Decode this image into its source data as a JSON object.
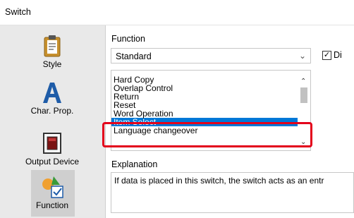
{
  "window": {
    "title": "Switch"
  },
  "sidebar": {
    "items": [
      {
        "label": "Style",
        "icon": "clipboard-icon"
      },
      {
        "label": "Char. Prop.",
        "icon": "letter-a-icon"
      },
      {
        "label": "Output Device",
        "icon": "switch-device-icon"
      },
      {
        "label": "Function",
        "icon": "shapes-icon",
        "selected": true
      }
    ]
  },
  "main": {
    "function_label": "Function",
    "function_value": "Standard",
    "checkbox_label": "Di",
    "checkbox_checked": true,
    "list_items": [
      "Hard Copy",
      "Overlap Control",
      "Return",
      "Reset",
      "Word Operation",
      "Item Select",
      "Language changeover"
    ],
    "selected_item": "Item Select",
    "explanation_label": "Explanation",
    "explanation_text": "If data is placed in this switch, the switch acts as an entr"
  },
  "colors": {
    "selection": "#0078d7",
    "highlight_border": "#e3001b",
    "sidebar_bg": "#e9e9e9"
  }
}
